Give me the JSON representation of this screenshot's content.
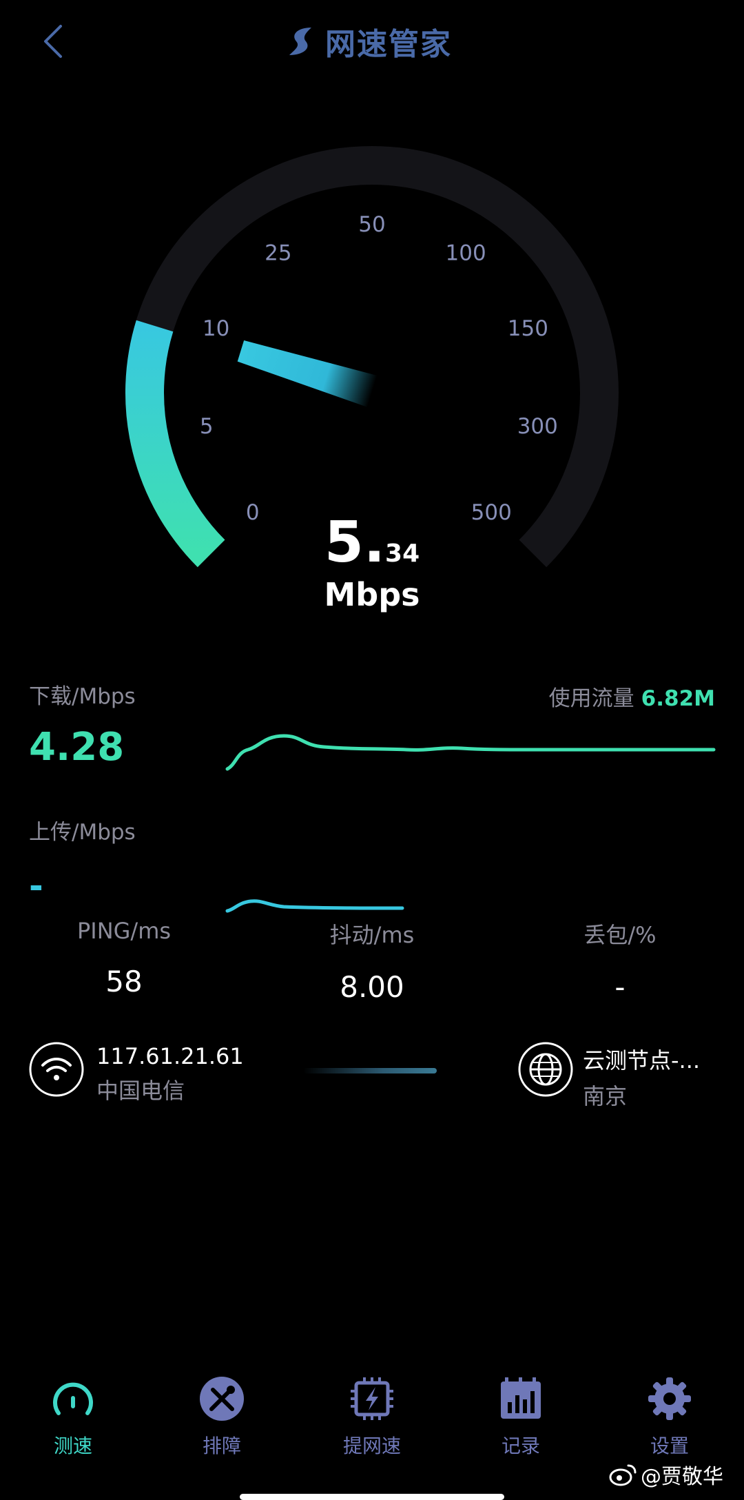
{
  "header": {
    "title": "网速管家",
    "back_icon": "chevron-left-icon"
  },
  "gauge": {
    "ticks": [
      "0",
      "5",
      "10",
      "25",
      "50",
      "100",
      "150",
      "300",
      "500"
    ],
    "speed_integer": "5.",
    "speed_decimal": "34",
    "unit": "Mbps",
    "level_fraction": 0.23,
    "accent_start": "#3fe0b0",
    "accent_end": "#38c8e0"
  },
  "download": {
    "label": "下载/Mbps",
    "value": "4.28",
    "usage_label": "使用流量",
    "usage_value": "6.82M"
  },
  "upload": {
    "label": "上传/Mbps",
    "value": "-"
  },
  "stats": {
    "ping": {
      "label": "PING/ms",
      "value": "58"
    },
    "jitter": {
      "label": "抖动/ms",
      "value": "8.00"
    },
    "loss": {
      "label": "丢包/%",
      "value": "-"
    }
  },
  "network": {
    "ip": "117.61.21.61",
    "isp": "中国电信",
    "node": "云测节点-...",
    "city": "南京"
  },
  "tabs": [
    {
      "label": "测速",
      "icon": "speedometer-icon",
      "active": true
    },
    {
      "label": "排障",
      "icon": "tools-icon",
      "active": false
    },
    {
      "label": "提网速",
      "icon": "chip-bolt-icon",
      "active": false
    },
    {
      "label": "记录",
      "icon": "bar-chart-icon",
      "active": false
    },
    {
      "label": "设置",
      "icon": "gear-icon",
      "active": false
    }
  ],
  "watermark": "@贾敬华"
}
